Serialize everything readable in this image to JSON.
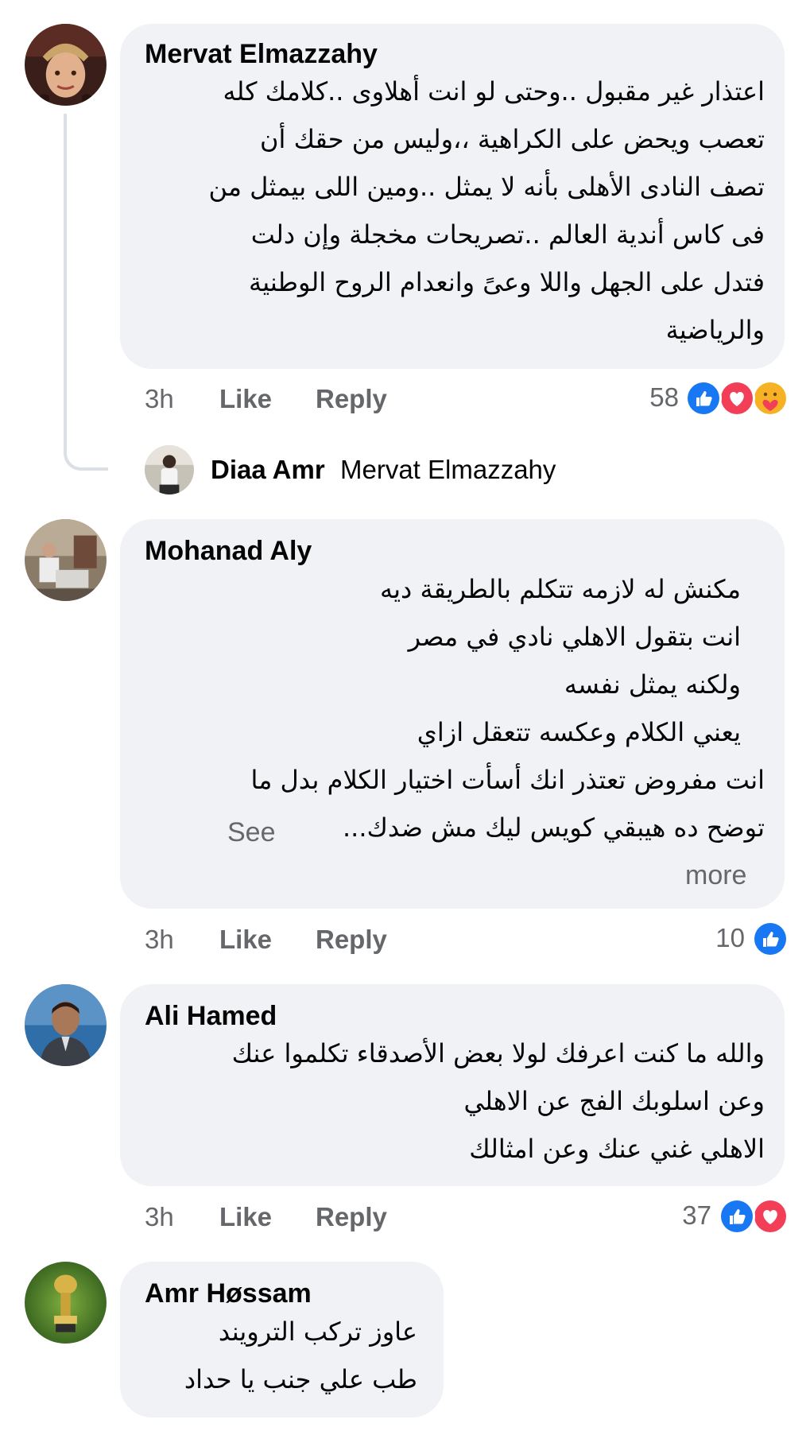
{
  "comments": [
    {
      "author": "Mervat Elmazzahy",
      "lines": [
        "اعتذار غير مقبول ..وحتى لو انت أهلاوى ..كلامك كله",
        "تعصب ويحض على الكراهية ،،وليس من حقك أن",
        "تصف النادى الأهلى بأنه لا يمثل ..ومين اللى بيمثل من",
        "فى كاس أندية العالم ..تصريحات مخجلة وإن دلت",
        "فتدل على الجهل واللا وعىً وانعدام الروح الوطنية",
        "والرياضية"
      ],
      "time": "3h",
      "like": "Like",
      "reply": "Reply",
      "reaction_count": "58",
      "reactions": [
        "like-icon",
        "love-icon",
        "care-icon"
      ]
    },
    {
      "author": "Mohanad Aly",
      "lines": [
        "مكنش له لازمه تتكلم بالطريقة ديه",
        "انت بتقول الاهلي نادي في مصر",
        "ولكنه يمثل نفسه",
        "يعني الكلام وعكسه تتعقل ازاي",
        "انت مفروض تعتذر انك أسأت اختيار الكلام بدل ما",
        "توضح ده هيبقي كويس ليك مش ضدك..."
      ],
      "see_more_1": "See",
      "see_more_2": "more",
      "time": "3h",
      "like": "Like",
      "reply": "Reply",
      "reaction_count": "10",
      "reactions": [
        "like-icon"
      ]
    },
    {
      "author": "Ali Hamed",
      "lines": [
        "والله ما كنت اعرفك لولا بعض الأصدقاء تكلموا عنك",
        "وعن اسلوبك الفج عن الاهلي",
        "الاهلي غني عنك وعن امثالك"
      ],
      "time": "3h",
      "like": "Like",
      "reply": "Reply",
      "reaction_count": "37",
      "reactions": [
        "like-icon",
        "love-icon"
      ]
    },
    {
      "author": "Amr Høssam",
      "lines": [
        "عاوز تركب الترويند",
        "طب علي جنب يا حداد"
      ]
    }
  ],
  "thread_reply": {
    "author": "Diaa Amr",
    "text": "Mervat Elmazzahy"
  },
  "colors": {
    "bubble": "#f0f2f5",
    "meta": "#65676b",
    "like_blue": "#1877f2",
    "love_red": "#f33e58",
    "care_yellow": "#f7b125"
  }
}
